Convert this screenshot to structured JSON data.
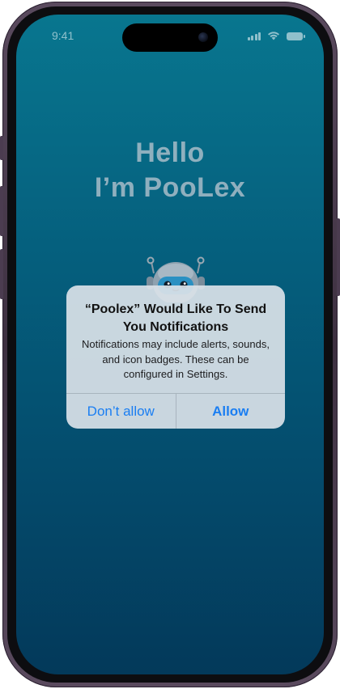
{
  "status_bar": {
    "time": "9:41",
    "icons": [
      "cellular-signal-icon",
      "wifi-icon",
      "battery-icon"
    ]
  },
  "greeting": {
    "line1": "Hello",
    "line2": "I’m PooLex"
  },
  "mascot": {
    "icon": "robot-mascot-icon"
  },
  "alert": {
    "title": "“Poolex” Would Like To Send You Notifications",
    "message": "Notifications may include alerts, sounds, and icon badges. These can be configured in Settings.",
    "buttons": {
      "deny": "Don’t allow",
      "allow": "Allow"
    }
  },
  "colors": {
    "background_top": "#08768f",
    "background_bottom": "#03395a",
    "alert_button": "#1a7ef2",
    "phone_frame": "#4b3c50"
  }
}
